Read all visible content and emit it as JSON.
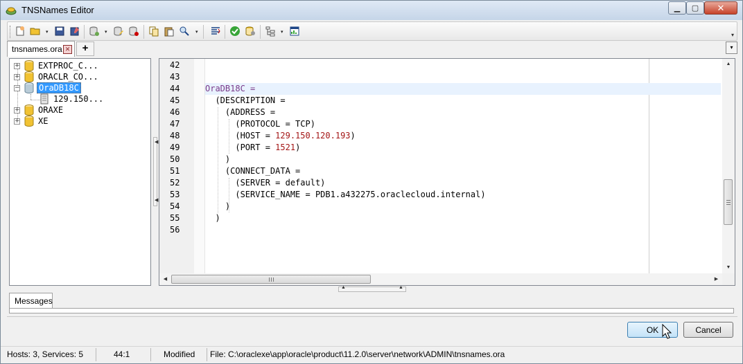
{
  "window": {
    "title": "TNSNames Editor",
    "controls": {
      "minimize": "▁",
      "maximize": "▢",
      "close": "✕"
    }
  },
  "toolbar": {
    "icons": [
      "new-file-icon",
      "open-file-icon",
      "save-icon",
      "save-as-icon",
      "add-database-icon",
      "edit-database-icon",
      "remove-database-icon",
      "copy-icon",
      "paste-icon",
      "find-replace-icon",
      "compare-icon",
      "validate-icon",
      "test-connection-icon",
      "tree-view-icon",
      "properties-icon"
    ],
    "dropdown_glyph": "▾",
    "overflow_glyph": "▾"
  },
  "tabs": {
    "items": [
      {
        "label": "tnsnames.ora",
        "close_glyph": "✕"
      }
    ],
    "add_label": "+",
    "dropdown_glyph": "▾"
  },
  "tree": {
    "expand_glyph": "+",
    "collapse_glyph": "−",
    "items": [
      {
        "label": "EXTPROC_C...",
        "expanded": false
      },
      {
        "label": "ORACLR_CO...",
        "expanded": false
      },
      {
        "label": "OraDB18C",
        "expanded": true,
        "selected": true
      },
      {
        "label": "129.150...",
        "child": true
      },
      {
        "label": "ORAXE",
        "expanded": false
      },
      {
        "label": "XE",
        "expanded": false
      }
    ]
  },
  "editor": {
    "current_line": 44,
    "lines": [
      {
        "num": "42",
        "text": ""
      },
      {
        "num": "43",
        "text": ""
      },
      {
        "num": "44",
        "text": "OraDB18C ="
      },
      {
        "num": "45",
        "text": "  (DESCRIPTION ="
      },
      {
        "num": "46",
        "text": "    (ADDRESS ="
      },
      {
        "num": "47",
        "text": "      (PROTOCOL = TCP)"
      },
      {
        "num": "48",
        "text": "      (HOST = 129.150.120.193)"
      },
      {
        "num": "49",
        "text": "      (PORT = 1521)"
      },
      {
        "num": "50",
        "text": "    )"
      },
      {
        "num": "51",
        "text": "    (CONNECT_DATA ="
      },
      {
        "num": "52",
        "text": "      (SERVER = default)"
      },
      {
        "num": "53",
        "text": "      (SERVICE_NAME = PDB1.a432275.oraclecloud.internal)"
      },
      {
        "num": "54",
        "text": "    )"
      },
      {
        "num": "55",
        "text": "  )"
      },
      {
        "num": "56",
        "text": ""
      }
    ]
  },
  "messages": {
    "tab_label": "Messages"
  },
  "buttons": {
    "ok": "OK",
    "cancel": "Cancel"
  },
  "status": {
    "hosts": "Hosts: 3, Services: 5",
    "position": "44:1",
    "state": "Modified",
    "file": "File: C:\\oraclexe\\app\\oracle\\product\\11.2.0\\server\\network\\ADMIN\\tnsnames.ora"
  },
  "colors": {
    "keyword": "#7a3a8a",
    "number": "#a31515",
    "selection": "#3399ff",
    "current_line": "#e8f2fe"
  }
}
